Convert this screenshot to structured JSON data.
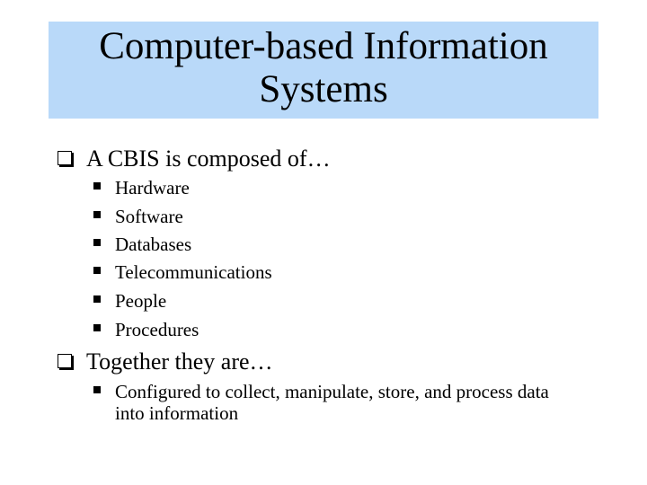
{
  "slide": {
    "title": "Computer-based Information Systems",
    "bullets": [
      {
        "text": "A CBIS is composed of…",
        "sub": [
          "Hardware",
          "Software",
          "Databases",
          "Telecommunications",
          "People",
          "Procedures"
        ]
      },
      {
        "text": "Together they are…",
        "sub": [
          "Configured to collect, manipulate, store, and process data into information"
        ]
      }
    ]
  },
  "colors": {
    "title_background": "#b9d9f9"
  }
}
